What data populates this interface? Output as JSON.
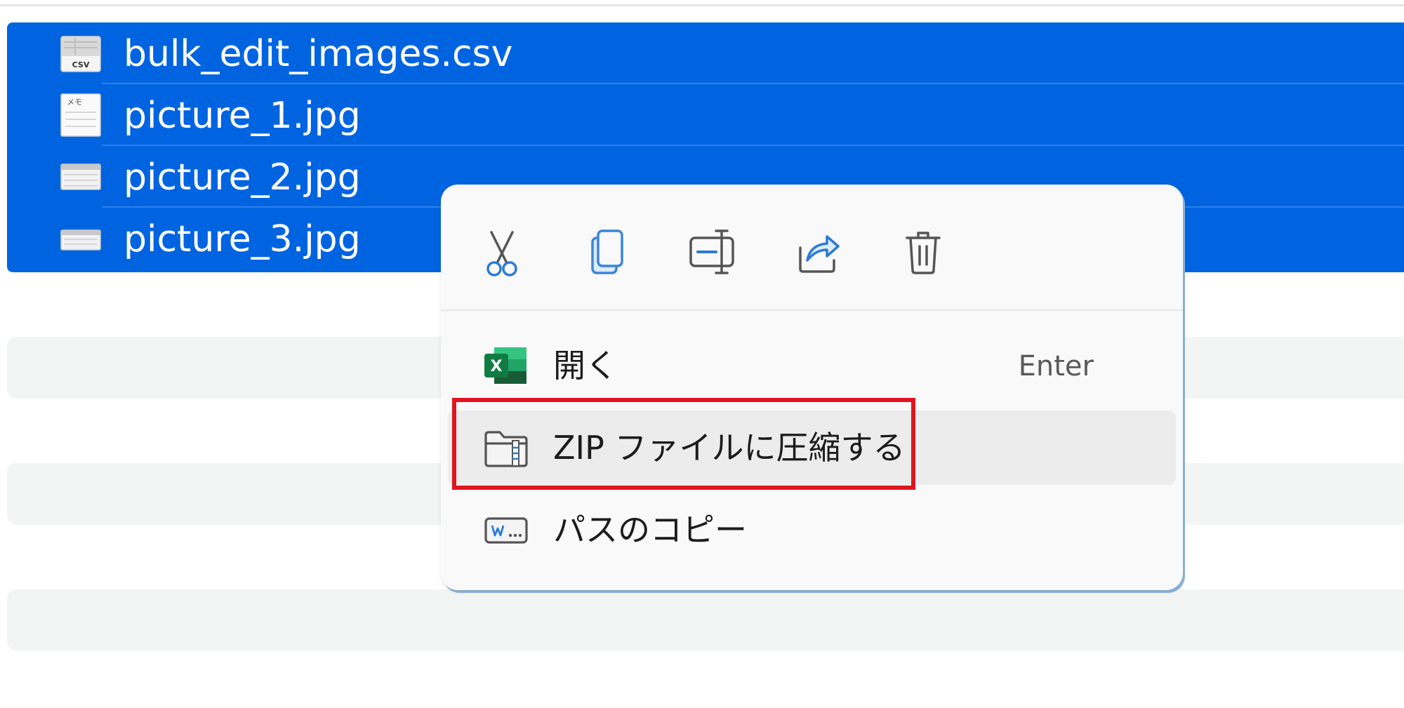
{
  "files": [
    {
      "name": "bulk_edit_images.csv",
      "icon": "csv-file-icon",
      "icon_label": "CSV"
    },
    {
      "name": "picture_1.jpg",
      "icon": "memo-file-icon",
      "icon_label": "メモ"
    },
    {
      "name": "picture_2.jpg",
      "icon": "image-file-icon"
    },
    {
      "name": "picture_3.jpg",
      "icon": "image-file-icon"
    }
  ],
  "context_menu": {
    "toolbar": [
      {
        "name": "cut",
        "icon": "scissors-icon"
      },
      {
        "name": "copy",
        "icon": "copy-icon"
      },
      {
        "name": "rename",
        "icon": "rename-icon"
      },
      {
        "name": "share",
        "icon": "share-icon"
      },
      {
        "name": "delete",
        "icon": "trash-icon"
      }
    ],
    "items": [
      {
        "label": "開く",
        "shortcut": "Enter",
        "icon": "excel-icon"
      },
      {
        "label": "ZIP ファイルに圧縮する",
        "icon": "zip-folder-icon"
      },
      {
        "label": "パスのコピー",
        "icon": "copy-path-icon"
      }
    ]
  },
  "colors": {
    "selection": "#0064e1",
    "highlight_border": "#e0151e",
    "menu_background": "#f9f9f9",
    "placeholder_row": "#f3f4f4",
    "excel_green": "#107c41"
  }
}
